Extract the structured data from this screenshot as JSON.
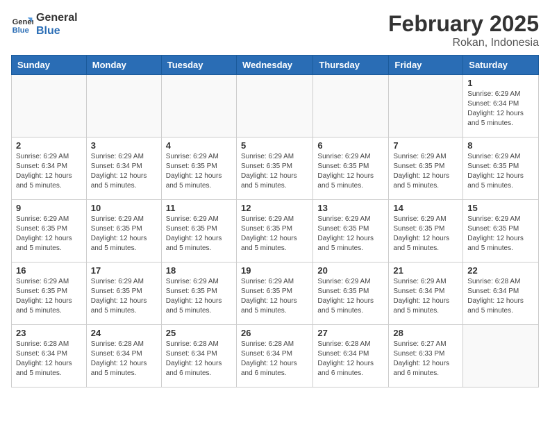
{
  "logo": {
    "line1": "General",
    "line2": "Blue"
  },
  "title": "February 2025",
  "subtitle": "Rokan, Indonesia",
  "days_of_week": [
    "Sunday",
    "Monday",
    "Tuesday",
    "Wednesday",
    "Thursday",
    "Friday",
    "Saturday"
  ],
  "weeks": [
    [
      {
        "day": "",
        "info": ""
      },
      {
        "day": "",
        "info": ""
      },
      {
        "day": "",
        "info": ""
      },
      {
        "day": "",
        "info": ""
      },
      {
        "day": "",
        "info": ""
      },
      {
        "day": "",
        "info": ""
      },
      {
        "day": "1",
        "info": "Sunrise: 6:29 AM\nSunset: 6:34 PM\nDaylight: 12 hours\nand 5 minutes."
      }
    ],
    [
      {
        "day": "2",
        "info": "Sunrise: 6:29 AM\nSunset: 6:34 PM\nDaylight: 12 hours\nand 5 minutes."
      },
      {
        "day": "3",
        "info": "Sunrise: 6:29 AM\nSunset: 6:34 PM\nDaylight: 12 hours\nand 5 minutes."
      },
      {
        "day": "4",
        "info": "Sunrise: 6:29 AM\nSunset: 6:35 PM\nDaylight: 12 hours\nand 5 minutes."
      },
      {
        "day": "5",
        "info": "Sunrise: 6:29 AM\nSunset: 6:35 PM\nDaylight: 12 hours\nand 5 minutes."
      },
      {
        "day": "6",
        "info": "Sunrise: 6:29 AM\nSunset: 6:35 PM\nDaylight: 12 hours\nand 5 minutes."
      },
      {
        "day": "7",
        "info": "Sunrise: 6:29 AM\nSunset: 6:35 PM\nDaylight: 12 hours\nand 5 minutes."
      },
      {
        "day": "8",
        "info": "Sunrise: 6:29 AM\nSunset: 6:35 PM\nDaylight: 12 hours\nand 5 minutes."
      }
    ],
    [
      {
        "day": "9",
        "info": "Sunrise: 6:29 AM\nSunset: 6:35 PM\nDaylight: 12 hours\nand 5 minutes."
      },
      {
        "day": "10",
        "info": "Sunrise: 6:29 AM\nSunset: 6:35 PM\nDaylight: 12 hours\nand 5 minutes."
      },
      {
        "day": "11",
        "info": "Sunrise: 6:29 AM\nSunset: 6:35 PM\nDaylight: 12 hours\nand 5 minutes."
      },
      {
        "day": "12",
        "info": "Sunrise: 6:29 AM\nSunset: 6:35 PM\nDaylight: 12 hours\nand 5 minutes."
      },
      {
        "day": "13",
        "info": "Sunrise: 6:29 AM\nSunset: 6:35 PM\nDaylight: 12 hours\nand 5 minutes."
      },
      {
        "day": "14",
        "info": "Sunrise: 6:29 AM\nSunset: 6:35 PM\nDaylight: 12 hours\nand 5 minutes."
      },
      {
        "day": "15",
        "info": "Sunrise: 6:29 AM\nSunset: 6:35 PM\nDaylight: 12 hours\nand 5 minutes."
      }
    ],
    [
      {
        "day": "16",
        "info": "Sunrise: 6:29 AM\nSunset: 6:35 PM\nDaylight: 12 hours\nand 5 minutes."
      },
      {
        "day": "17",
        "info": "Sunrise: 6:29 AM\nSunset: 6:35 PM\nDaylight: 12 hours\nand 5 minutes."
      },
      {
        "day": "18",
        "info": "Sunrise: 6:29 AM\nSunset: 6:35 PM\nDaylight: 12 hours\nand 5 minutes."
      },
      {
        "day": "19",
        "info": "Sunrise: 6:29 AM\nSunset: 6:35 PM\nDaylight: 12 hours\nand 5 minutes."
      },
      {
        "day": "20",
        "info": "Sunrise: 6:29 AM\nSunset: 6:35 PM\nDaylight: 12 hours\nand 5 minutes."
      },
      {
        "day": "21",
        "info": "Sunrise: 6:29 AM\nSunset: 6:34 PM\nDaylight: 12 hours\nand 5 minutes."
      },
      {
        "day": "22",
        "info": "Sunrise: 6:28 AM\nSunset: 6:34 PM\nDaylight: 12 hours\nand 5 minutes."
      }
    ],
    [
      {
        "day": "23",
        "info": "Sunrise: 6:28 AM\nSunset: 6:34 PM\nDaylight: 12 hours\nand 5 minutes."
      },
      {
        "day": "24",
        "info": "Sunrise: 6:28 AM\nSunset: 6:34 PM\nDaylight: 12 hours\nand 5 minutes."
      },
      {
        "day": "25",
        "info": "Sunrise: 6:28 AM\nSunset: 6:34 PM\nDaylight: 12 hours\nand 6 minutes."
      },
      {
        "day": "26",
        "info": "Sunrise: 6:28 AM\nSunset: 6:34 PM\nDaylight: 12 hours\nand 6 minutes."
      },
      {
        "day": "27",
        "info": "Sunrise: 6:28 AM\nSunset: 6:34 PM\nDaylight: 12 hours\nand 6 minutes."
      },
      {
        "day": "28",
        "info": "Sunrise: 6:27 AM\nSunset: 6:33 PM\nDaylight: 12 hours\nand 6 minutes."
      },
      {
        "day": "",
        "info": ""
      }
    ]
  ]
}
